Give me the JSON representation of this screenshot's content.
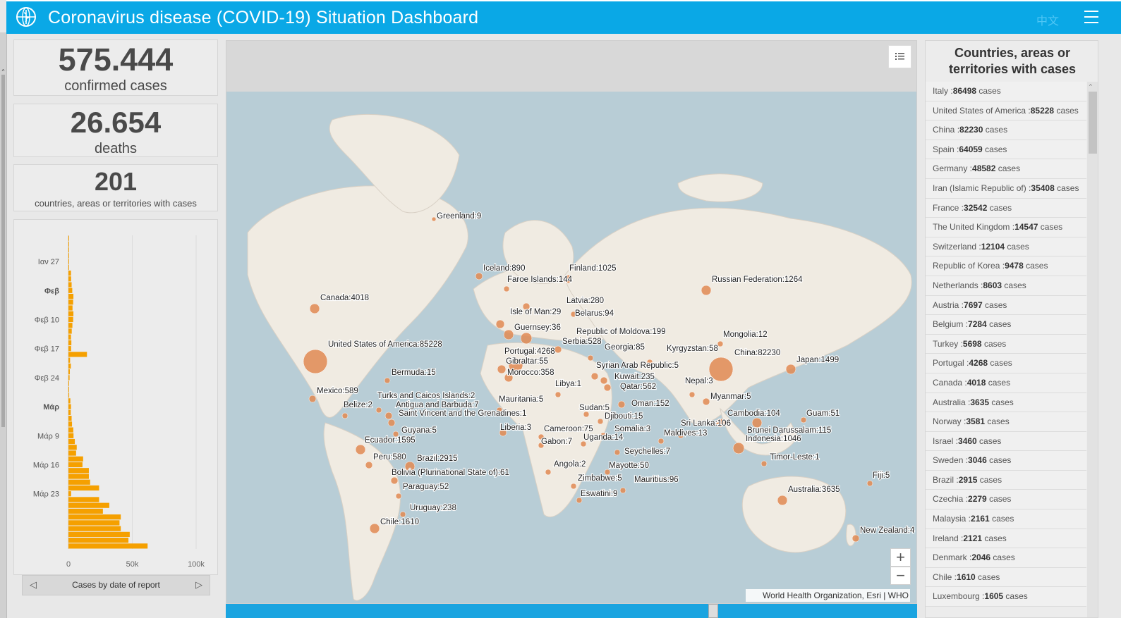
{
  "header": {
    "title": "Coronavirus disease (COVID-19) Situation Dashboard",
    "language": "中文",
    "logo_icon": "who-emblem-icon",
    "menu_icon": "hamburger-menu-icon",
    "color": "#0aa8e6"
  },
  "stats": {
    "confirmed_value": "575.444",
    "confirmed_label": "confirmed cases",
    "deaths_value": "26.654",
    "deaths_label": "deaths",
    "countries_value": "201",
    "countries_label": "countries, areas or territories with cases"
  },
  "chart_footer": {
    "label": "Cases by date of report",
    "prev_icon": "chevron-left-icon",
    "next_icon": "chevron-right-icon"
  },
  "chart_data": {
    "type": "bar",
    "orientation": "horizontal",
    "y_tick_labels": [
      "Ιαν 27",
      "Φεβ",
      "Φεβ 10",
      "Φεβ 17",
      "Φεβ 24",
      "Μάρ",
      "Μάρ 9",
      "Μάρ 16",
      "Μάρ 23"
    ],
    "y_tick_indices": [
      4,
      9,
      14,
      19,
      24,
      29,
      34,
      39,
      44
    ],
    "x_ticks": [
      "0",
      "50k",
      "100k"
    ],
    "xlim": [
      0,
      100000
    ],
    "color": "#f5a000",
    "values": [
      1,
      60,
      70,
      80,
      100,
      200,
      2000,
      2100,
      2500,
      3000,
      3900,
      3700,
      3200,
      3900,
      3700,
      3100,
      2600,
      2000,
      2300,
      2100,
      14500,
      1300,
      1900,
      1100,
      900,
      500,
      400,
      600,
      1500,
      2000,
      1800,
      2500,
      2800,
      3800,
      4000,
      5000,
      6500,
      6000,
      11500,
      11000,
      16000,
      16000,
      17000,
      24000,
      2100,
      24000,
      32000,
      27000,
      41000,
      40000,
      41000,
      48000,
      47000,
      62000
    ]
  },
  "map": {
    "legend_icon": "legend-list-icon",
    "zoom_in": "+",
    "zoom_out": "−",
    "attribution": "World Health Organization, Esri | WHO",
    "water_color": "#b8cdd6",
    "land_color": "#f0ebe2",
    "bubble_color": "#e08a52",
    "labels": [
      "Greenland:9",
      "Iceland:890",
      "Finland:1025",
      "Faroe Islands:144",
      "Russian Federation:1264",
      "Canada:4018",
      "Latvia:280",
      "Isle of Man:29",
      "Belarus:94",
      "Guernsey:36",
      "Republic of Moldova:199",
      "Mongolia:12",
      "Serbia:528",
      "Georgia:85",
      "Kyrgyzstan:58",
      "Portugal:4268",
      "China:82230",
      "Gibraltar:55",
      "Japan:1499",
      "Syrian Arab Republic:5",
      "United States of America:85228",
      "Bermuda:15",
      "Morocco:358",
      "Kuwait:235",
      "Libya:1",
      "Qatar:562",
      "Nepal:3",
      "Mexico:589",
      "Turks and Caicos Islands:2",
      "Myanmar:5",
      "Belize:2",
      "Antigua and Barbuda:7",
      "Mauritania:5",
      "Oman:152",
      "Saint Vincent and the Grenadines:1",
      "Sudan:5",
      "Cambodia:104",
      "Guam:51",
      "Djibouti:15",
      "Sri Lanka:106",
      "Guyana:5",
      "Liberia:3",
      "Cameroon:75",
      "Somalia:3",
      "Maldives:13",
      "Brunei Darussalam:115",
      "Ecuador:1595",
      "Uganda:14",
      "Indonesia:1046",
      "Gabon:7",
      "Seychelles:7",
      "Peru:580",
      "Brazil:2915",
      "Timor-Leste:1",
      "Angola:2",
      "Mayotte:50",
      "Bolivia (Plurinational State of):61",
      "Fiji:5",
      "Zimbabwe:5",
      "Mauritius:96",
      "Paraguay:52",
      "Australia:3635",
      "Eswatini:9",
      "Uruguay:238",
      "Chile:1610",
      "New Zealand:4"
    ]
  },
  "countries_panel": {
    "title": "Countries, areas or territories with cases",
    "unit": "cases",
    "items": [
      {
        "name": "Italy :",
        "value": "86498"
      },
      {
        "name": "United States of America :",
        "value": "85228"
      },
      {
        "name": "China :",
        "value": "82230"
      },
      {
        "name": "Spain :",
        "value": "64059"
      },
      {
        "name": "Germany :",
        "value": "48582"
      },
      {
        "name": "Iran (Islamic Republic of) :",
        "value": "35408"
      },
      {
        "name": "France :",
        "value": "32542"
      },
      {
        "name": "The United Kingdom :",
        "value": "14547"
      },
      {
        "name": "Switzerland :",
        "value": "12104"
      },
      {
        "name": "Republic of Korea :",
        "value": "9478"
      },
      {
        "name": "Netherlands :",
        "value": "8603"
      },
      {
        "name": "Austria :",
        "value": "7697"
      },
      {
        "name": "Belgium :",
        "value": "7284"
      },
      {
        "name": "Turkey :",
        "value": "5698"
      },
      {
        "name": "Portugal :",
        "value": "4268"
      },
      {
        "name": "Canada :",
        "value": "4018"
      },
      {
        "name": "Australia :",
        "value": "3635"
      },
      {
        "name": "Norway :",
        "value": "3581"
      },
      {
        "name": "Israel :",
        "value": "3460"
      },
      {
        "name": "Sweden :",
        "value": "3046"
      },
      {
        "name": "Brazil :",
        "value": "2915"
      },
      {
        "name": "Czechia :",
        "value": "2279"
      },
      {
        "name": "Malaysia :",
        "value": "2161"
      },
      {
        "name": "Ireland :",
        "value": "2121"
      },
      {
        "name": "Denmark :",
        "value": "2046"
      },
      {
        "name": "Chile :",
        "value": "1610"
      },
      {
        "name": "Luxembourg :",
        "value": "1605"
      }
    ]
  }
}
